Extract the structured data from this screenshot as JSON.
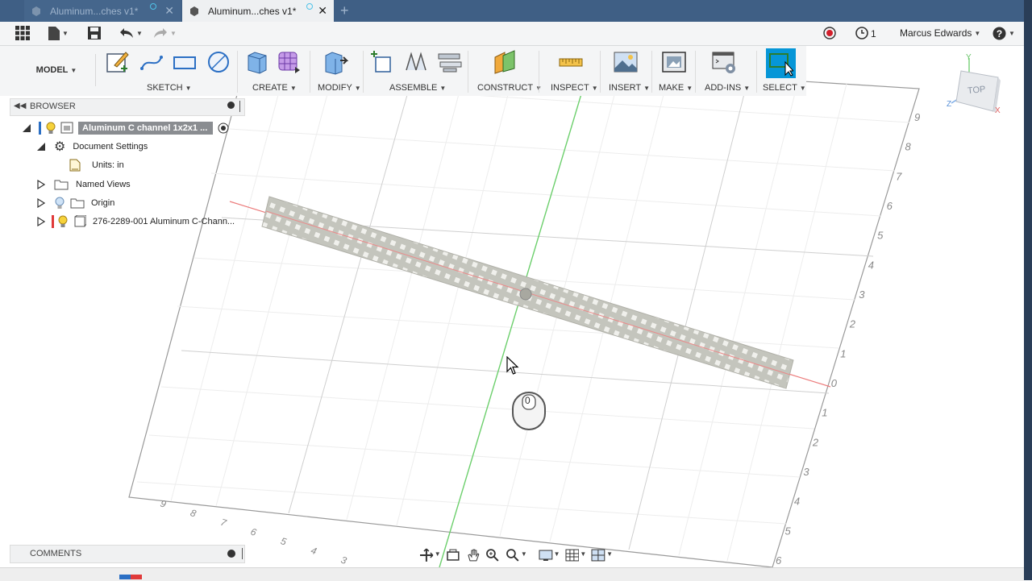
{
  "tabs": [
    {
      "label": "Aluminum...ches v1*",
      "active": false
    },
    {
      "label": "Aluminum...ches v1*",
      "active": true
    }
  ],
  "quick_access": {
    "job_count": "1",
    "user": "Marcus Edwards"
  },
  "ribbon": {
    "workspace": "MODEL",
    "groups": [
      "SKETCH",
      "CREATE",
      "MODIFY",
      "ASSEMBLE",
      "CONSTRUCT",
      "INSPECT",
      "INSERT",
      "MAKE",
      "ADD-INS",
      "SELECT"
    ]
  },
  "browser": {
    "title": "BROWSER",
    "root": "Aluminum C channel 1x2x1 ...",
    "document_settings": "Document Settings",
    "units": "Units: in",
    "named_views": "Named Views",
    "origin": "Origin",
    "component": "276-2289-001 Aluminum C-Chann..."
  },
  "comments": {
    "title": "COMMENTS"
  },
  "viewcube": {
    "face": "TOP",
    "axes": [
      "Y",
      "Z",
      "X"
    ]
  },
  "grid": {
    "right_ticks": [
      "9",
      "8",
      "7",
      "6",
      "5",
      "4",
      "3",
      "2",
      "1",
      "0",
      "1",
      "2",
      "3",
      "4",
      "5",
      "6"
    ],
    "bottom_ticks": [
      "9",
      "8",
      "7",
      "6",
      "5",
      "4",
      "3"
    ]
  },
  "mouse_hint": {
    "button": "0"
  },
  "colors": {
    "title_bar": "#3f5f85",
    "select_active": "#0696d7",
    "x_axis": "#e06060",
    "y_axis": "#55c955",
    "channel": "#c9c9c0"
  }
}
